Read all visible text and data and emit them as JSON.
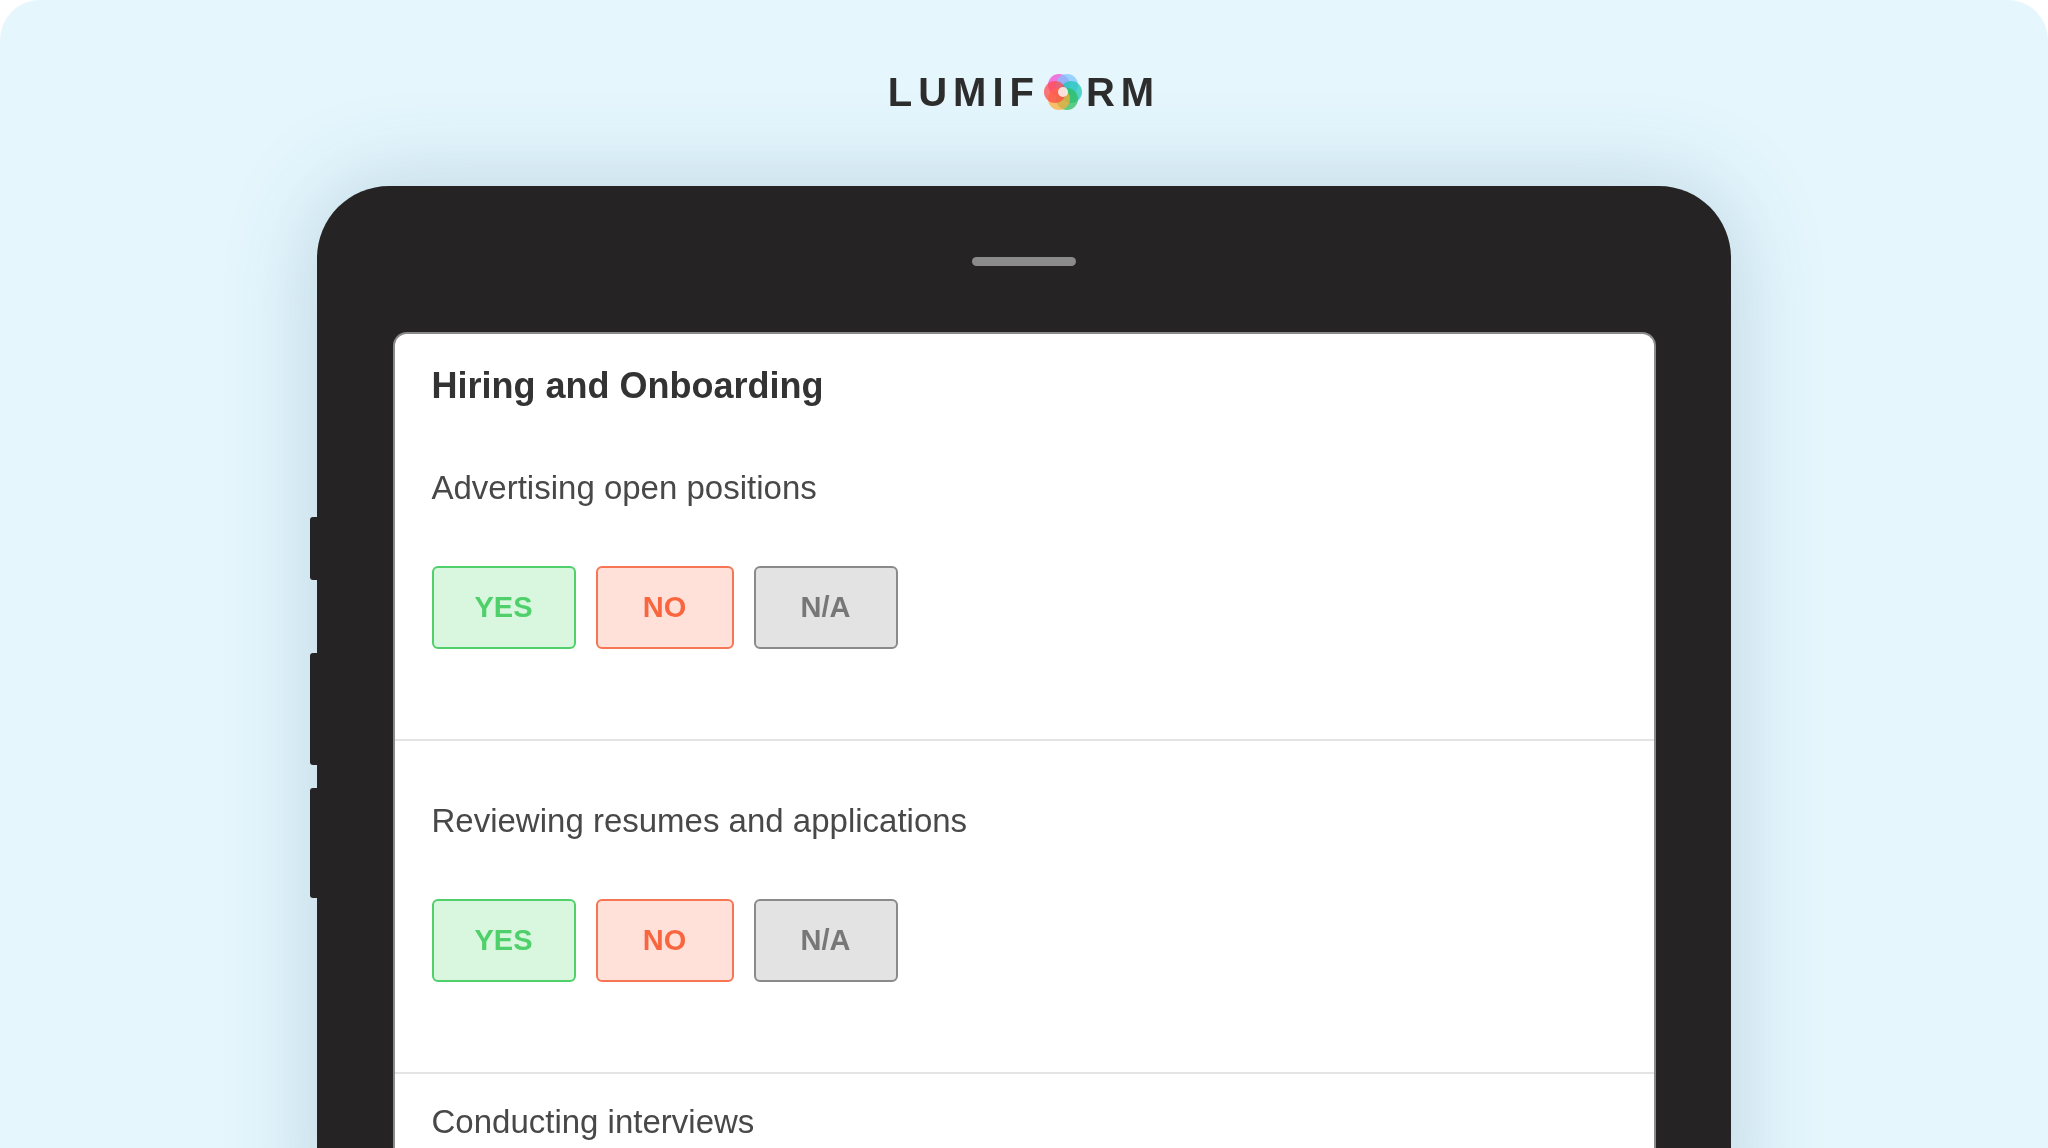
{
  "logo": {
    "before": "LUMIF",
    "after": "RM"
  },
  "form": {
    "title": "Hiring and Onboarding",
    "questions": [
      {
        "label": "Advertising open positions",
        "answers": [
          {
            "label": "YES",
            "kind": "yes"
          },
          {
            "label": "NO",
            "kind": "no"
          },
          {
            "label": "N/A",
            "kind": "na"
          }
        ]
      },
      {
        "label": "Reviewing resumes and applications",
        "answers": [
          {
            "label": "YES",
            "kind": "yes"
          },
          {
            "label": "NO",
            "kind": "no"
          },
          {
            "label": "N/A",
            "kind": "na"
          }
        ]
      },
      {
        "label": "Conducting interviews"
      }
    ]
  }
}
